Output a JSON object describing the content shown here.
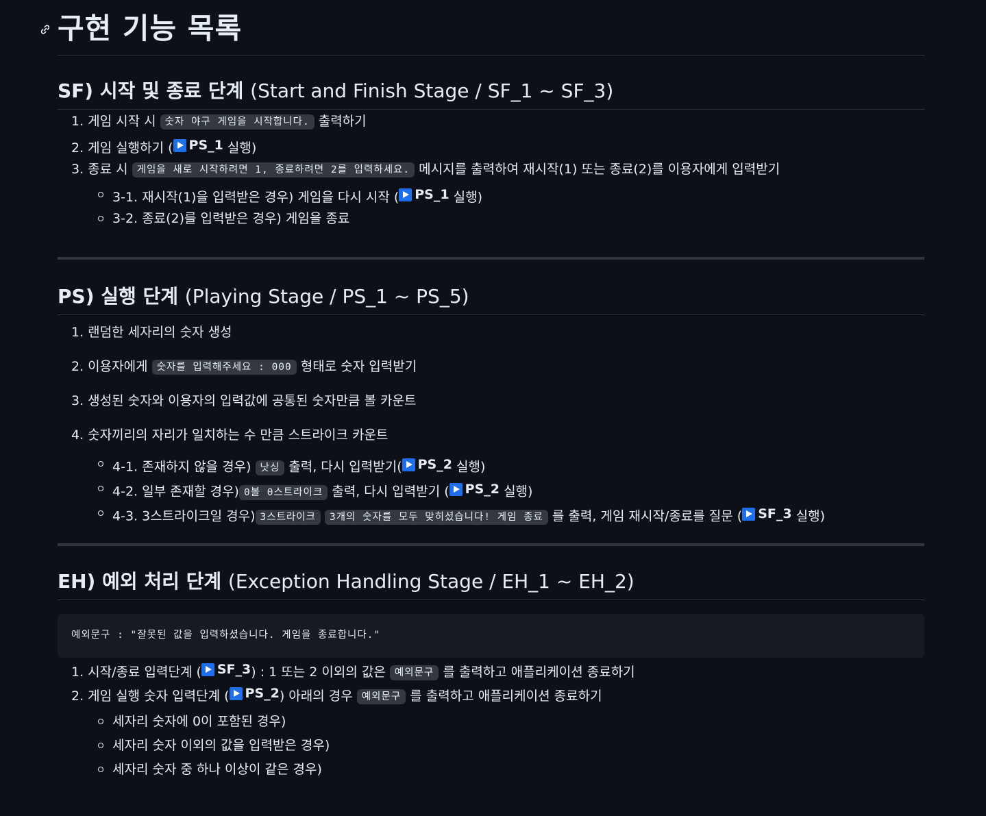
{
  "title": "구현 기능 목록",
  "sf": {
    "heading_ko": "SF) 시작 및 종료 단계",
    "heading_en": "(Start and Finish Stage / SF_1 ~ SF_3)",
    "items": [
      {
        "num": "1.",
        "pre": "게임 시작 시",
        "code": "숫자 야구 게임을 시작합니다.",
        "post": "출력하기"
      },
      {
        "num": "2.",
        "pre": "게임 실행하기 (",
        "ref": "PS_1",
        "post": "실행)"
      },
      {
        "num": "3.",
        "pre": "종료 시",
        "code": "게임을 새로 시작하려면 1, 종료하려면 2를 입력하세요.",
        "post": "메시지를 출력하여 재시작(1) 또는 종료(2)를 이용자에게 입력받기"
      }
    ],
    "sub": [
      {
        "pre": "3-1. 재시작(1)을 입력받은 경우) 게임을 다시 시작 (",
        "ref": "PS_1",
        "post": "실행)"
      },
      {
        "text": "3-2. 종료(2)를 입력받은 경우) 게임을 종료"
      }
    ]
  },
  "ps": {
    "heading_ko": "PS) 실행 단계",
    "heading_en": "(Playing Stage / PS_1 ~ PS_5)",
    "items": [
      {
        "num": "1.",
        "text": "랜덤한 세자리의 숫자 생성"
      },
      {
        "num": "2.",
        "pre": "이용자에게",
        "code": "숫자를 입력해주세요 : 000",
        "post": "형태로 숫자 입력받기"
      },
      {
        "num": "3.",
        "text": "생성된 숫자와 이용자의 입력값에 공통된 숫자만큼 볼 카운트"
      },
      {
        "num": "4.",
        "text": "숫자끼리의 자리가 일치하는 수 만큼 스트라이크 카운트"
      }
    ],
    "sub": [
      {
        "pre": "4-1. 존재하지 않을 경우)",
        "code": "낫싱",
        "mid": "출력, 다시 입력받기(",
        "ref": "PS_2",
        "post": "실행)"
      },
      {
        "pre": "4-2. 일부 존재할 경우)",
        "code": "0볼 0스트라이크",
        "mid": "출력, 다시 입력받기 (",
        "ref": "PS_2",
        "post": "실행)"
      },
      {
        "pre": "4-3. 3스트라이크일 경우)",
        "code": "3스트라이크",
        "code2": "3개의 숫자를 모두 맞히셨습니다! 게임 종료",
        "mid": "를 출력, 게임 재시작/종료를 질문 (",
        "ref": "SF_3",
        "post": "실행)"
      }
    ]
  },
  "eh": {
    "heading_ko": "EH) 예외 처리 단계",
    "heading_en": "(Exception Handling Stage / EH_1 ~ EH_2)",
    "code_block": "예외문구 : \"잘못된 값을 입력하셨습니다. 게임을 종료합니다.\"",
    "items": [
      {
        "num": "1.",
        "pre": "시작/종료 입력단계 (",
        "ref": "SF_3",
        "mid": ") : 1 또는 2 이외의 값은",
        "code": "예외문구",
        "post": "를 출력하고 애플리케이션 종료하기"
      },
      {
        "num": "2.",
        "pre": "게임 실행 숫자 입력단계 (",
        "ref": "PS_2",
        "mid": ") 아래의 경우",
        "code": "예외문구",
        "post": "를 출력하고 애플리케이션 종료하기"
      }
    ],
    "sub": [
      {
        "text": "세자리 숫자에 0이 포함된 경우)"
      },
      {
        "text": "세자리 숫자 이외의 값을 입력받은 경우)"
      },
      {
        "text": "세자리 숫자 중 하나 이상이 같은 경우)"
      }
    ]
  }
}
